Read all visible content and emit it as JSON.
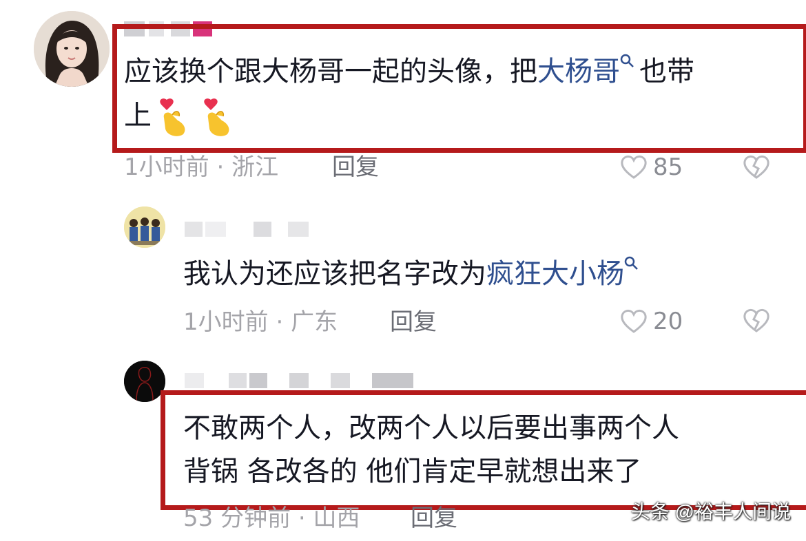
{
  "comments": [
    {
      "text_before": "应该换个跟大杨哥一起的头像，把",
      "link": "大杨哥",
      "text_after_line1": "也带",
      "line2": "上",
      "emojis": [
        "finger-heart",
        "finger-heart"
      ],
      "time": "1小时前",
      "location": "浙江",
      "reply": "回复",
      "likes": "85"
    },
    {
      "text_before": "我认为还应该把名字改为",
      "link": "疯狂大小杨",
      "time": "1小时前",
      "location": "广东",
      "reply": "回复",
      "likes": "20"
    },
    {
      "line1": "不敢两个人，改两个人以后要出事两个人",
      "line2": "背锅 各改各的 他们肯定早就想出来了",
      "time": "53 分钟前",
      "location": "山西",
      "reply": "回复"
    }
  ],
  "separator": "·",
  "watermark": "头条 @裕丰人间说",
  "colors": {
    "highlight_box": "#b51a1b",
    "link": "#2f4f8f"
  },
  "icons": [
    "search-icon",
    "heart-outline-icon",
    "broken-heart-icon"
  ]
}
